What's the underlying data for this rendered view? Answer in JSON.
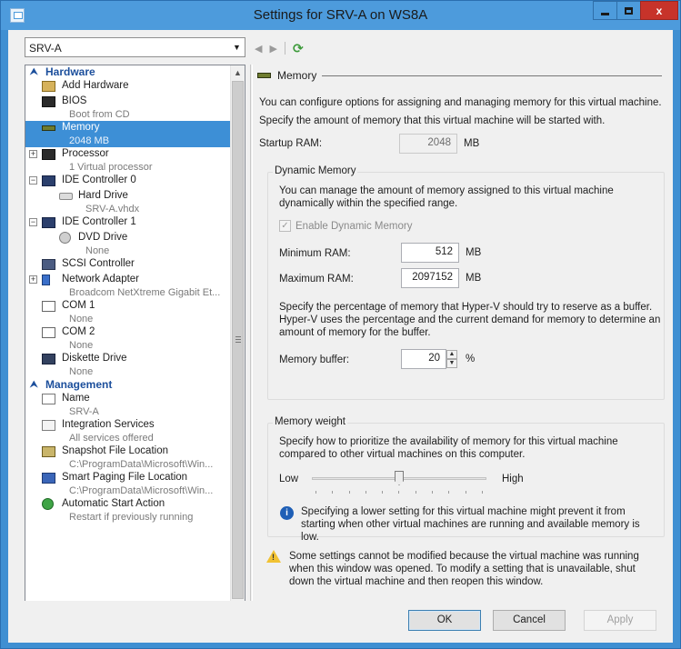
{
  "window": {
    "title": "Settings for SRV-A on WS8A",
    "minimize_label": "–",
    "maximize_label": "□",
    "close_label": "x"
  },
  "vm_selector": {
    "value": "SRV-A",
    "dropdown_arrow": "▼"
  },
  "nav": {
    "back": "◀",
    "forward": "▶",
    "refresh": "⟳"
  },
  "sidebar": {
    "hardware_header": "Hardware",
    "management_header": "Management",
    "hardware_items": [
      {
        "label": "Add Hardware",
        "sub": "",
        "icon": "add-hardware-icon",
        "level": 1
      },
      {
        "label": "BIOS",
        "sub": "Boot from CD",
        "icon": "bios-icon",
        "level": 1
      },
      {
        "label": "Memory",
        "sub": "2048 MB",
        "icon": "memory-icon",
        "level": 1,
        "selected": true
      },
      {
        "label": "Processor",
        "sub": "1 Virtual processor",
        "icon": "processor-icon",
        "level": 1,
        "expander": "+"
      },
      {
        "label": "IDE Controller 0",
        "sub": "",
        "icon": "ide-controller-icon",
        "level": 1,
        "expander": "−"
      },
      {
        "label": "Hard Drive",
        "sub": "SRV-A.vhdx",
        "icon": "hard-drive-icon",
        "level": 2
      },
      {
        "label": "IDE Controller 1",
        "sub": "",
        "icon": "ide-controller-icon",
        "level": 1,
        "expander": "−"
      },
      {
        "label": "DVD Drive",
        "sub": "None",
        "icon": "dvd-drive-icon",
        "level": 2
      },
      {
        "label": "SCSI Controller",
        "sub": "",
        "icon": "scsi-controller-icon",
        "level": 1
      },
      {
        "label": "Network Adapter",
        "sub": "Broadcom NetXtreme Gigabit Et...",
        "icon": "network-adapter-icon",
        "level": 1,
        "expander": "+"
      },
      {
        "label": "COM 1",
        "sub": "None",
        "icon": "com-port-icon",
        "level": 1
      },
      {
        "label": "COM 2",
        "sub": "None",
        "icon": "com-port-icon",
        "level": 1
      },
      {
        "label": "Diskette Drive",
        "sub": "None",
        "icon": "diskette-drive-icon",
        "level": 1
      }
    ],
    "management_items": [
      {
        "label": "Name",
        "sub": "SRV-A",
        "icon": "name-icon"
      },
      {
        "label": "Integration Services",
        "sub": "All services offered",
        "icon": "integration-services-icon"
      },
      {
        "label": "Snapshot File Location",
        "sub": "C:\\ProgramData\\Microsoft\\Win...",
        "icon": "snapshot-icon"
      },
      {
        "label": "Smart Paging File Location",
        "sub": "C:\\ProgramData\\Microsoft\\Win...",
        "icon": "smart-paging-icon"
      },
      {
        "label": "Automatic Start Action",
        "sub": "Restart if previously running",
        "icon": "automatic-start-icon"
      }
    ]
  },
  "memory": {
    "section_title": "Memory",
    "intro": "You can configure options for assigning and managing memory for this virtual machine.",
    "startup_desc": "Specify the amount of memory that this virtual machine will be started with.",
    "startup_label": "Startup RAM:",
    "startup_value": "2048",
    "unit_mb": "MB",
    "dynamic": {
      "legend": "Dynamic Memory",
      "desc": "You can manage the amount of memory assigned to this virtual machine dynamically within the specified range.",
      "enable_label": "Enable Dynamic Memory",
      "enable_checked": true,
      "minimum_label": "Minimum RAM:",
      "minimum_value": "512",
      "maximum_label": "Maximum RAM:",
      "maximum_value": "2097152",
      "buffer_desc": "Specify the percentage of memory that Hyper-V should try to reserve as a buffer. Hyper-V uses the percentage and the current demand for memory to determine an amount of memory for the buffer.",
      "buffer_label": "Memory buffer:",
      "buffer_value": "20",
      "percent": "%"
    },
    "weight": {
      "legend": "Memory weight",
      "desc": "Specify how to prioritize the availability of memory for this virtual machine compared to other virtual machines on this computer.",
      "low": "Low",
      "high": "High",
      "slider_fraction": 0.5,
      "info": "Specifying a lower setting for this virtual machine might prevent it from starting when other virtual machines are running and available memory is low."
    },
    "warning": "Some settings cannot be modified because the virtual machine was running when this window was opened. To modify a setting that is unavailable, shut down the virtual machine and then reopen this window."
  },
  "buttons": {
    "ok": "OK",
    "cancel": "Cancel",
    "apply": "Apply"
  }
}
